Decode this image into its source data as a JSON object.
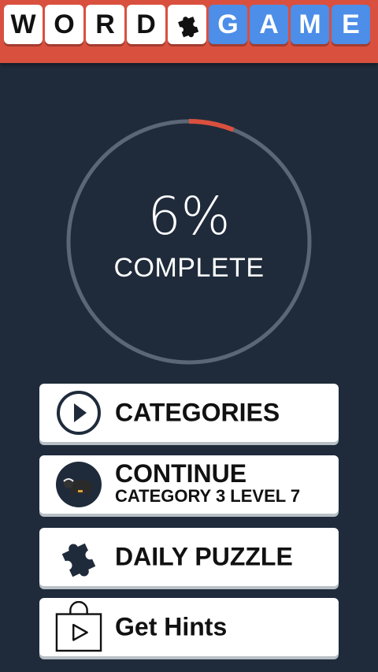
{
  "header": {
    "word_tiles": [
      "W",
      "O",
      "R",
      "D"
    ],
    "game_tiles": [
      "G",
      "A",
      "M",
      "E"
    ],
    "accent_color": "#d9503f",
    "tile_blue": "#4c8ee8"
  },
  "progress": {
    "percent_text": "6%",
    "percent_value": 6,
    "label": "COMPLETE",
    "track_color": "#5b6676",
    "fill_color": "#d9503f"
  },
  "menu": {
    "categories": {
      "label": "CATEGORIES",
      "icon": "play-circle-icon"
    },
    "continue": {
      "label": "CONTINUE",
      "subtitle": "CATEGORY 3 LEVEL 7",
      "icon": "buffalo-avatar-icon"
    },
    "daily": {
      "label": "DAILY PUZZLE",
      "icon": "puzzle-piece-icon"
    },
    "hints": {
      "label": "Get Hints",
      "icon": "shopping-bag-play-icon"
    }
  }
}
